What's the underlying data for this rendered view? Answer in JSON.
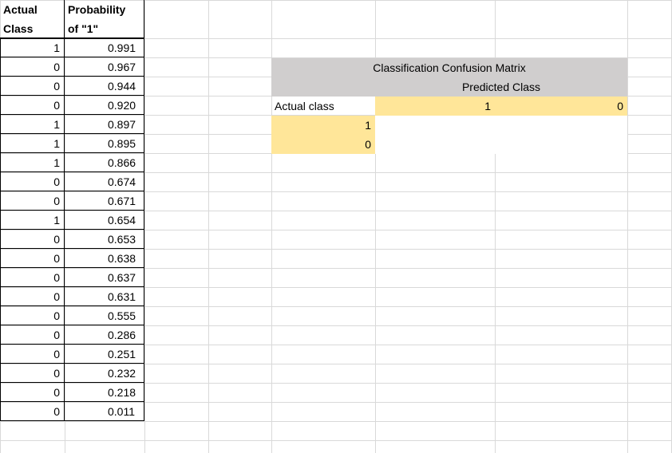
{
  "table": {
    "header_actual": [
      "Actual",
      "Class"
    ],
    "header_prob": [
      "Probability",
      "of \"1\""
    ],
    "rows": [
      {
        "actual": "1",
        "prob": "0.991"
      },
      {
        "actual": "0",
        "prob": "0.967"
      },
      {
        "actual": "0",
        "prob": "0.944"
      },
      {
        "actual": "0",
        "prob": "0.920"
      },
      {
        "actual": "1",
        "prob": "0.897"
      },
      {
        "actual": "1",
        "prob": "0.895"
      },
      {
        "actual": "1",
        "prob": "0.866"
      },
      {
        "actual": "0",
        "prob": "0.674"
      },
      {
        "actual": "0",
        "prob": "0.671"
      },
      {
        "actual": "1",
        "prob": "0.654"
      },
      {
        "actual": "0",
        "prob": "0.653"
      },
      {
        "actual": "0",
        "prob": "0.638"
      },
      {
        "actual": "0",
        "prob": "0.637"
      },
      {
        "actual": "0",
        "prob": "0.631"
      },
      {
        "actual": "0",
        "prob": "0.555"
      },
      {
        "actual": "0",
        "prob": "0.286"
      },
      {
        "actual": "0",
        "prob": "0.251"
      },
      {
        "actual": "0",
        "prob": "0.232"
      },
      {
        "actual": "0",
        "prob": "0.218"
      },
      {
        "actual": "0",
        "prob": "0.011"
      }
    ]
  },
  "matrix": {
    "title": "Classification Confusion Matrix",
    "predicted_label": "Predicted Class",
    "actual_label": "Actual class",
    "predicted_values": [
      "1",
      "0"
    ],
    "actual_values": [
      "1",
      "0"
    ]
  },
  "colors": {
    "gray_fill": "#d0cece",
    "yellow_fill": "#ffe699",
    "gridline": "#d9d9d9"
  }
}
